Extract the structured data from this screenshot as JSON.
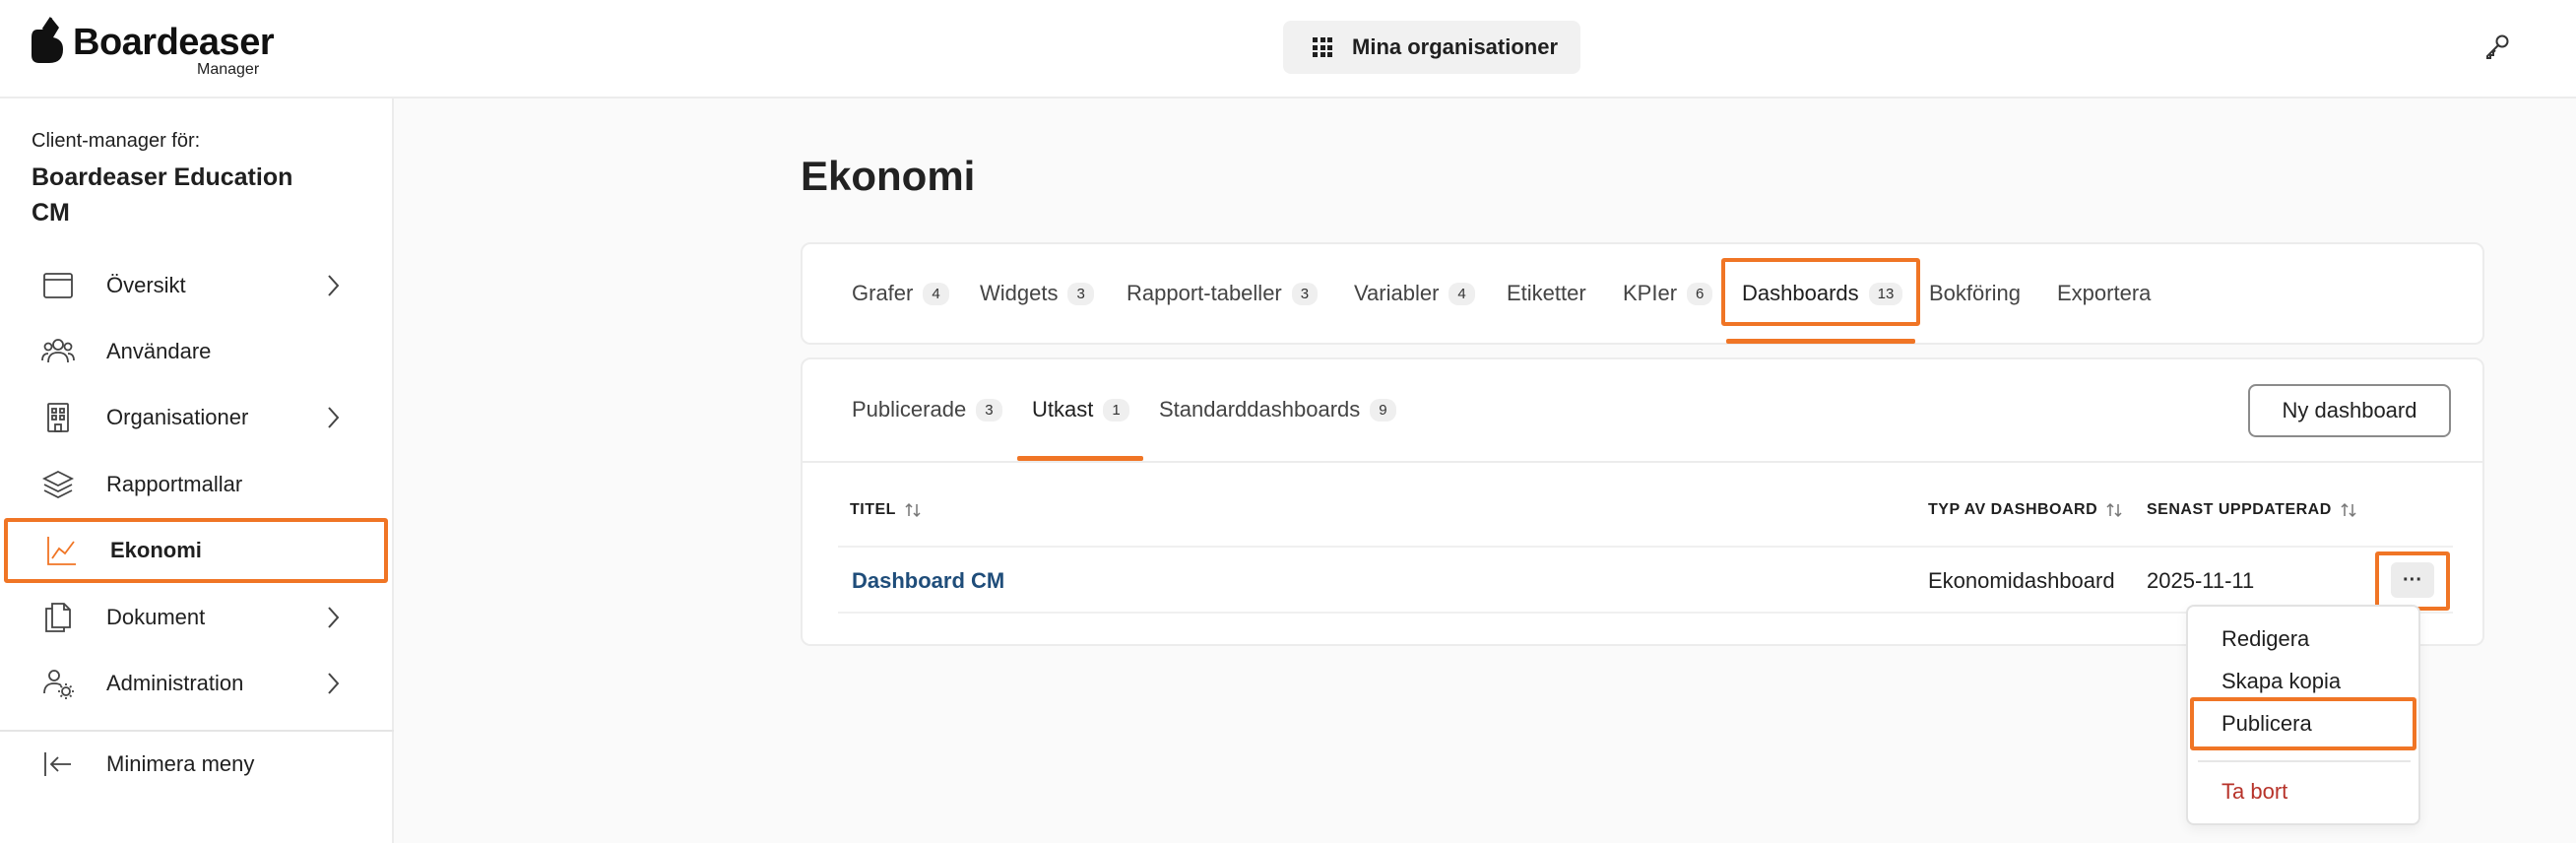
{
  "header": {
    "logo_text": "Boardeaser",
    "logo_sub": "Manager",
    "org_button_label": "Mina organisationer"
  },
  "sidebar": {
    "client_label": "Client-manager för:",
    "client_name": "Boardeaser Education CM",
    "items": [
      {
        "label": "Översikt",
        "icon": "browser-window-icon",
        "has_chevron": true
      },
      {
        "label": "Användare",
        "icon": "users-icon",
        "has_chevron": false
      },
      {
        "label": "Organisationer",
        "icon": "building-icon",
        "has_chevron": true
      },
      {
        "label": "Rapportmallar",
        "icon": "layers-icon",
        "has_chevron": false
      },
      {
        "label": "Ekonomi",
        "icon": "line-chart-icon",
        "has_chevron": false,
        "active": true
      },
      {
        "label": "Dokument",
        "icon": "documents-icon",
        "has_chevron": true
      },
      {
        "label": "Administration",
        "icon": "users-gear-icon",
        "has_chevron": true
      }
    ],
    "minimize_label": "Minimera meny"
  },
  "main": {
    "title": "Ekonomi",
    "tabs": [
      {
        "label": "Grafer",
        "count": "4"
      },
      {
        "label": "Widgets",
        "count": "3"
      },
      {
        "label": "Rapport-tabeller",
        "count": "3"
      },
      {
        "label": "Variabler",
        "count": "4"
      },
      {
        "label": "Etiketter",
        "count": ""
      },
      {
        "label": "KPIer",
        "count": "6"
      },
      {
        "label": "Dashboards",
        "count": "13",
        "active": true
      },
      {
        "label": "Bokföring",
        "count": ""
      },
      {
        "label": "Exportera",
        "count": ""
      }
    ],
    "sub_tabs": [
      {
        "label": "Publicerade",
        "count": "3"
      },
      {
        "label": "Utkast",
        "count": "1",
        "active": true
      },
      {
        "label": "Standarddashboards",
        "count": "9"
      }
    ],
    "new_button_label": "Ny dashboard",
    "table": {
      "columns": [
        "TITEL",
        "TYP AV DASHBOARD",
        "SENAST UPPDATERAD"
      ],
      "rows": [
        {
          "title": "Dashboard CM",
          "type": "Ekonomidashboard",
          "updated": "2025-11-11"
        }
      ]
    },
    "row_menu": {
      "button_label": "···",
      "items": [
        "Redigera",
        "Skapa kopia",
        "Publicera",
        "Ta bort"
      ]
    }
  },
  "colors": {
    "accent": "#f07525",
    "link": "#1f4d7a",
    "danger": "#b7332a"
  }
}
